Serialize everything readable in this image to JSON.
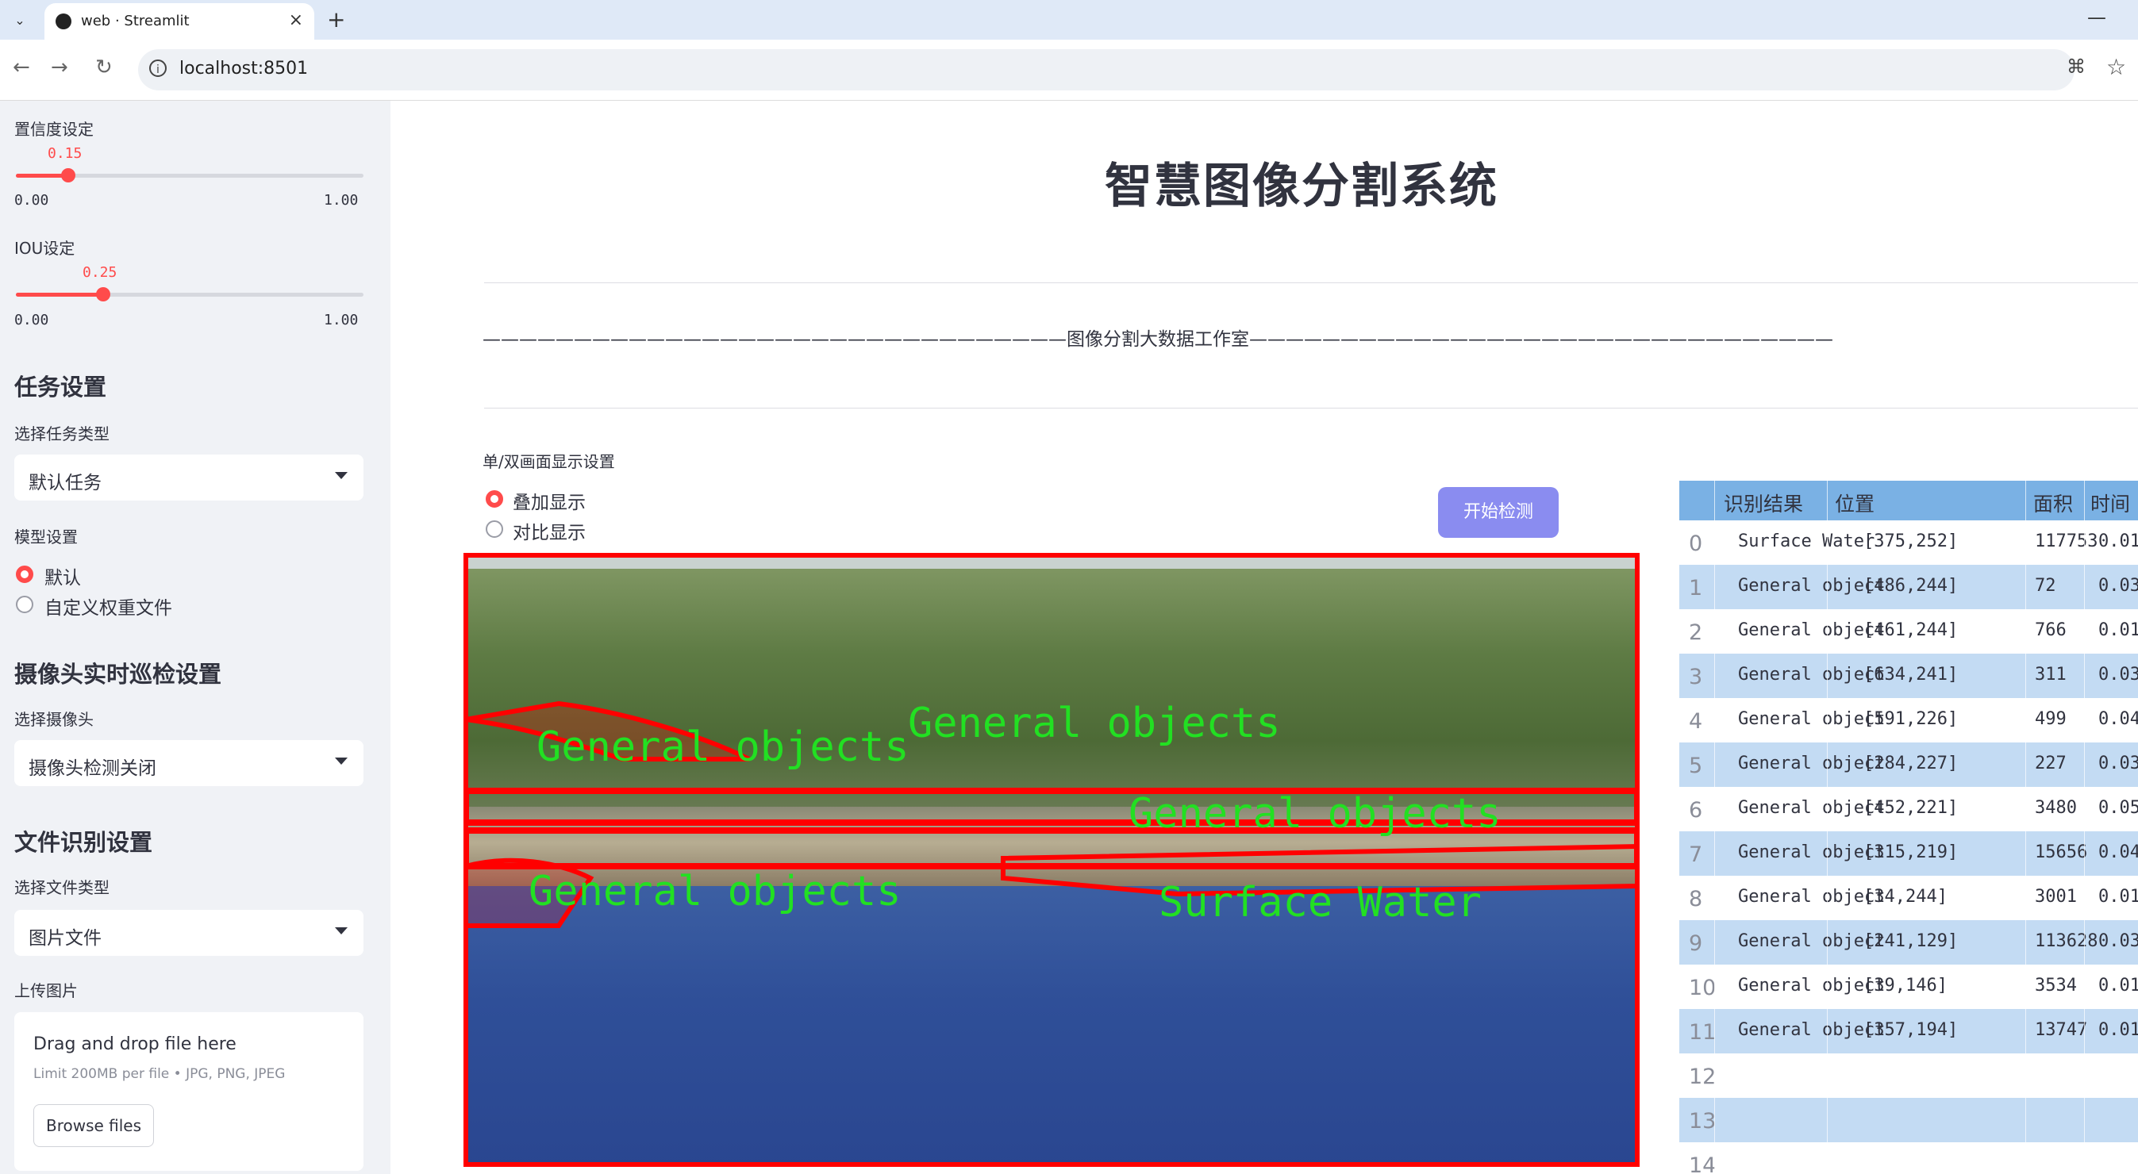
{
  "browser": {
    "tab_title": "web · Streamlit",
    "url": "localhost:8501",
    "new_tab_symbol": "+",
    "close_symbol": "×",
    "minimize_symbol": "—"
  },
  "sidebar": {
    "confidence": {
      "label": "置信度设定",
      "value": "0.15",
      "fraction": 0.15,
      "min": "0.00",
      "max": "1.00"
    },
    "iou": {
      "label": "IOU设定",
      "value": "0.25",
      "fraction": 0.25,
      "min": "0.00",
      "max": "1.00"
    },
    "task_section": {
      "heading": "任务设置",
      "select_label": "选择任务类型",
      "selected": "默认任务"
    },
    "model_section": {
      "label": "模型设置",
      "options": [
        "默认",
        "自定义权重文件"
      ],
      "selected_index": 0
    },
    "camera_section": {
      "heading": "摄像头实时巡检设置",
      "select_label": "选择摄像头",
      "selected": "摄像头检测关闭"
    },
    "file_section": {
      "heading": "文件识别设置",
      "select_label": "选择文件类型",
      "selected": "图片文件"
    },
    "upload": {
      "label": "上传图片",
      "title": "Drag and drop file here",
      "subtitle": "Limit 200MB per file • JPG, PNG, JPEG",
      "button": "Browse files"
    }
  },
  "main": {
    "title": "智慧图像分割系统",
    "subtitle_line": "————————————————————————————————图像分割大数据工作室————————————————————————————————",
    "display_label": "单/双画面显示设置",
    "display_options": [
      "叠加显示",
      "对比显示"
    ],
    "display_selected_index": 0,
    "start_button": "开始检测",
    "image_labels": [
      "General objects",
      "General objects",
      "General objects",
      "General objects",
      "Surface Water"
    ]
  },
  "results_table": {
    "headers": [
      "识别结果",
      "位置",
      "面积",
      "时间"
    ],
    "rows": [
      {
        "idx": "0",
        "result": "Surface Water",
        "position": "[375,252]",
        "area": "117753",
        "time": "0.01"
      },
      {
        "idx": "1",
        "result": "General object",
        "position": "[486,244]",
        "area": "72",
        "time": "0.03"
      },
      {
        "idx": "2",
        "result": "General object",
        "position": "[461,244]",
        "area": "766",
        "time": "0.01"
      },
      {
        "idx": "3",
        "result": "General object",
        "position": "[634,241]",
        "area": "311",
        "time": "0.03"
      },
      {
        "idx": "4",
        "result": "General object",
        "position": "[591,226]",
        "area": "499",
        "time": "0.04"
      },
      {
        "idx": "5",
        "result": "General object",
        "position": "[284,227]",
        "area": "227",
        "time": "0.03"
      },
      {
        "idx": "6",
        "result": "General object",
        "position": "[452,221]",
        "area": "3480",
        "time": "0.05"
      },
      {
        "idx": "7",
        "result": "General object",
        "position": "[315,219]",
        "area": "15656",
        "time": "0.04"
      },
      {
        "idx": "8",
        "result": "General object",
        "position": "[34,244]",
        "area": "3001",
        "time": "0.01"
      },
      {
        "idx": "9",
        "result": "General object",
        "position": "[241,129]",
        "area": "113628",
        "time": "0.03"
      },
      {
        "idx": "10",
        "result": "General object",
        "position": "[39,146]",
        "area": "3534",
        "time": "0.01"
      },
      {
        "idx": "11",
        "result": "General object",
        "position": "[357,194]",
        "area": "13747",
        "time": "0.01"
      },
      {
        "idx": "12",
        "result": "",
        "position": "",
        "area": "",
        "time": ""
      },
      {
        "idx": "13",
        "result": "",
        "position": "",
        "area": "",
        "time": ""
      },
      {
        "idx": "14",
        "result": "",
        "position": "",
        "area": "",
        "time": ""
      }
    ]
  },
  "colors": {
    "accent": "#ff4b4b",
    "sidebar_bg": "#f0f2f6",
    "button": "#8a8cf0",
    "table_header": "#7ab1e4",
    "table_stripe": "#c3dbf3",
    "mask_outline": "#ff0000",
    "mask_label": "#22e022"
  },
  "icons": {
    "tab_menu": "chevron-down-icon",
    "back": "arrow-left-icon",
    "forward": "arrow-right-icon",
    "reload": "reload-icon",
    "site_info": "info-icon",
    "translate": "translate-icon",
    "bookmark": "star-icon"
  }
}
